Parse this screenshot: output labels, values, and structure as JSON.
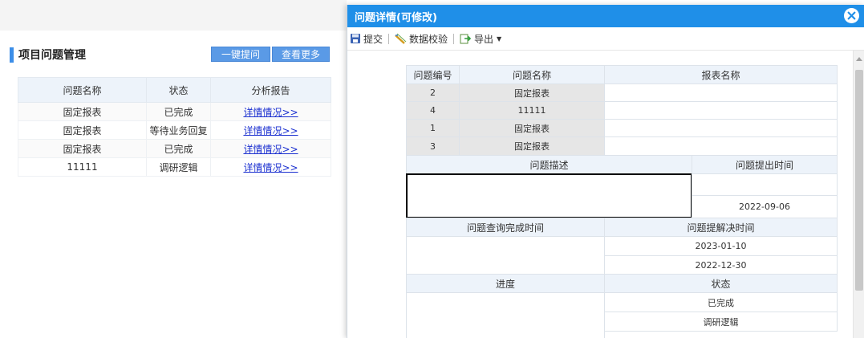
{
  "main": {
    "title": "项目问题管理",
    "buttons": {
      "quick_submit": "一键提问",
      "see_more": "查看更多"
    },
    "table": {
      "headers": [
        "问题名称",
        "状态",
        "分析报告"
      ],
      "rows": [
        {
          "name": "固定报表",
          "status": "已完成",
          "report": "详情情况>>"
        },
        {
          "name": "固定报表",
          "status": "等待业务回复",
          "report": "详情情况>>"
        },
        {
          "name": "固定报表",
          "status": "已完成",
          "report": "详情情况>>"
        },
        {
          "name": "11111",
          "status": "调研逻辑",
          "report": "详情情况>>"
        }
      ]
    }
  },
  "dialog": {
    "title": "问题详情(可修改)",
    "toolbar": {
      "submit": "提交",
      "validate": "数据校验",
      "export": "导出"
    },
    "grid": {
      "headers": [
        "问题编号",
        "问题名称",
        "报表名称"
      ],
      "rows": [
        {
          "id": "2",
          "name": "固定报表",
          "report": ""
        },
        {
          "id": "4",
          "name": "11111",
          "report": ""
        },
        {
          "id": "1",
          "name": "固定报表",
          "report": ""
        },
        {
          "id": "3",
          "name": "固定报表",
          "report": ""
        }
      ],
      "desc_header": "问题描述",
      "submit_time_header": "问题提出时间",
      "submit_time_value": "2022-09-06",
      "query_done_header": "问题查询完成时间",
      "resolve_time_header": "问题提解决时间",
      "resolve_times": [
        "2023-01-10",
        "2022-12-30"
      ],
      "progress_header": "进度",
      "status_header": "状态",
      "statuses": [
        "已完成",
        "调研逻辑"
      ]
    }
  },
  "colors": {
    "accent": "#1f8fe8",
    "button": "#5a9ae6",
    "header_bg": "#edf3fa",
    "link": "#1a2fd0"
  }
}
